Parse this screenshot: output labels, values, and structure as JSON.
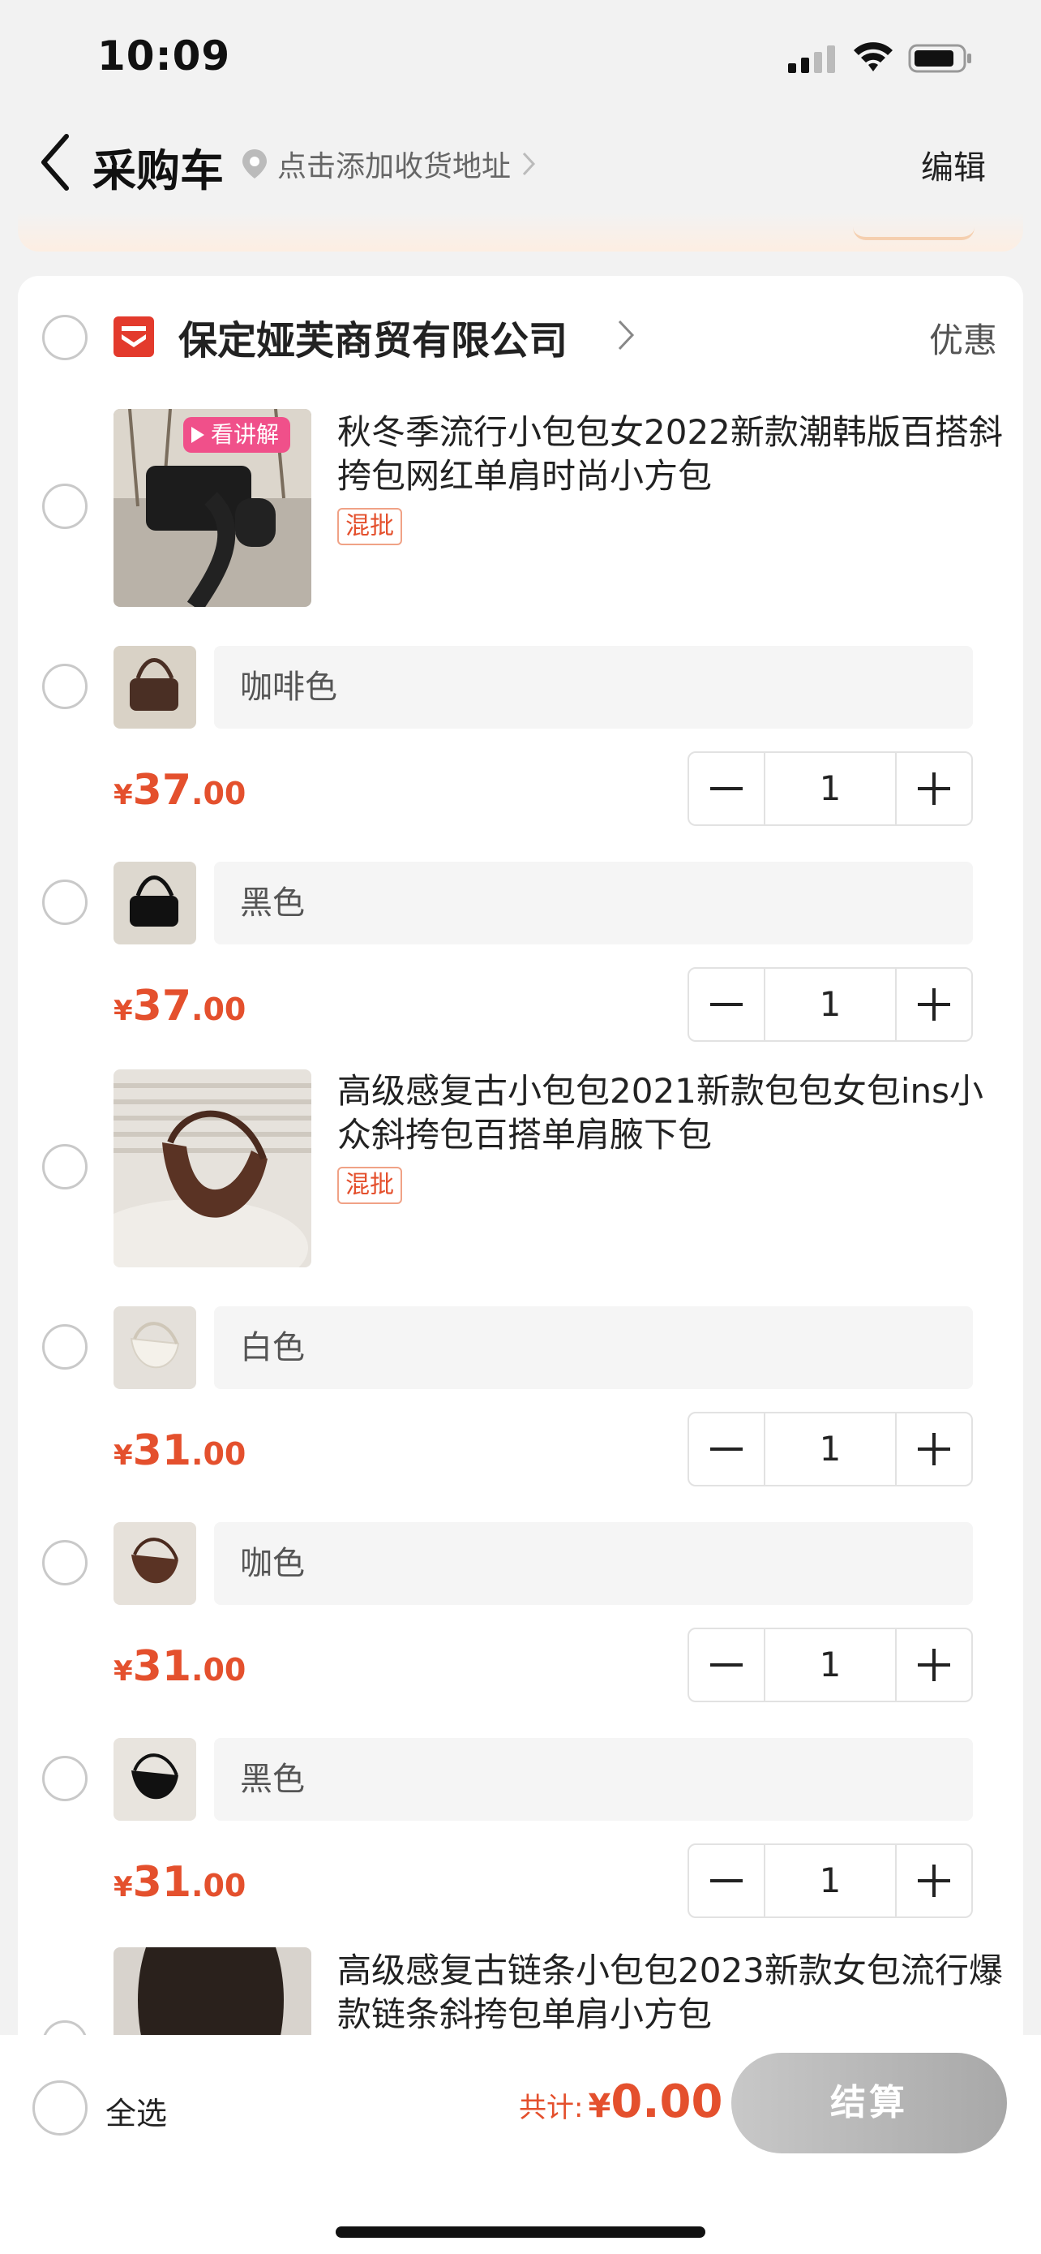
{
  "status": {
    "time": "10:09"
  },
  "nav": {
    "title": "采购车",
    "address": "点击添加收货地址",
    "edit": "编辑"
  },
  "shop": {
    "name": "保定娅芙商贸有限公司",
    "promo": "优惠"
  },
  "products": [
    {
      "title": "秋冬季流行小包包女2022新款潮韩版百搭斜挎包网红单肩时尚小方包",
      "tag": "混批",
      "live_badge": "看讲解",
      "variants": [
        {
          "spec": "咖啡色",
          "currency": "¥",
          "price_int": "37",
          "price_dec": ".00",
          "qty": "1"
        },
        {
          "spec": "黑色",
          "currency": "¥",
          "price_int": "37",
          "price_dec": ".00",
          "qty": "1"
        }
      ]
    },
    {
      "title": "高级感复古小包包2021新款包包女包ins小众斜挎包百搭单肩腋下包",
      "tag": "混批",
      "variants": [
        {
          "spec": "白色",
          "currency": "¥",
          "price_int": "31",
          "price_dec": ".00",
          "qty": "1"
        },
        {
          "spec": "咖色",
          "currency": "¥",
          "price_int": "31",
          "price_dec": ".00",
          "qty": "1"
        },
        {
          "spec": "黑色",
          "currency": "¥",
          "price_int": "31",
          "price_dec": ".00",
          "qty": "1"
        }
      ]
    },
    {
      "title": "高级感复古链条小包包2023新款女包流行爆款链条斜挎包单肩小方包"
    }
  ],
  "footer": {
    "select_all": "全选",
    "total_label": "共计:",
    "currency": "¥",
    "total": "0.00",
    "checkout": "结算"
  },
  "colors": {
    "accent": "#e4502d",
    "shop_icon": "#e33a2c",
    "live_badge": "#f0508a"
  },
  "icons": [
    "signal-icon",
    "wifi-icon",
    "battery-icon",
    "back-chevron-icon",
    "location-pin-icon",
    "chevron-right-icon",
    "shop-icon",
    "minus-icon",
    "plus-icon"
  ]
}
